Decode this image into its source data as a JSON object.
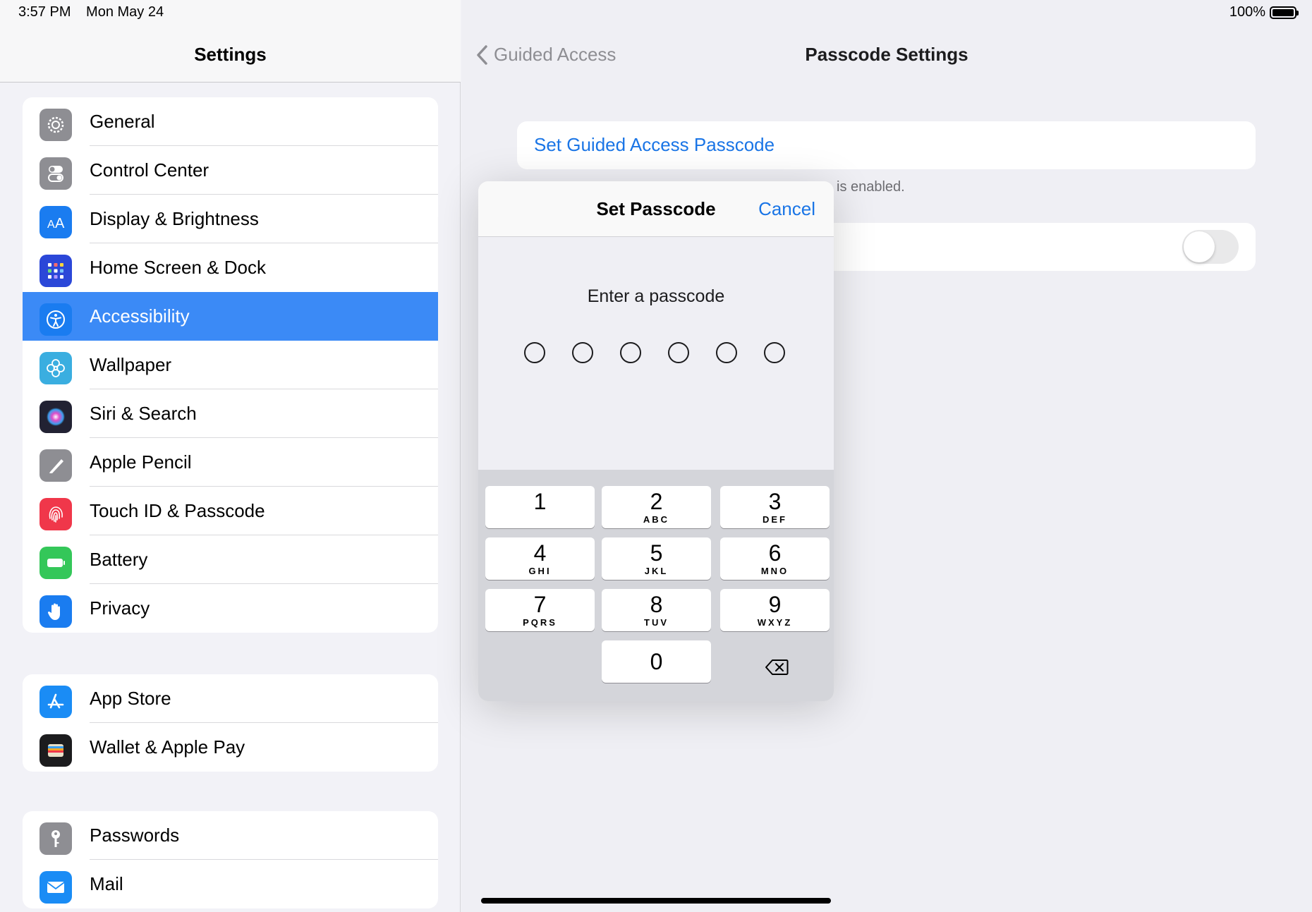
{
  "status": {
    "time": "3:57 PM",
    "date": "Mon May 24",
    "battery": "100%"
  },
  "sidebar": {
    "title": "Settings",
    "groups": [
      [
        {
          "label": "General",
          "icon": "gear-icon",
          "color": "#8e8e93"
        },
        {
          "label": "Control Center",
          "icon": "toggles-icon",
          "color": "#8e8e93"
        },
        {
          "label": "Display & Brightness",
          "icon": "text-size-icon",
          "color": "#1a7cf0"
        },
        {
          "label": "Home Screen & Dock",
          "icon": "app-grid-icon",
          "color": "#2b47d8"
        },
        {
          "label": "Accessibility",
          "icon": "accessibility-icon",
          "color": "#1a7cf0",
          "selected": true
        },
        {
          "label": "Wallpaper",
          "icon": "flower-icon",
          "color": "#3aaee0"
        },
        {
          "label": "Siri & Search",
          "icon": "siri-icon",
          "color": "#222233"
        },
        {
          "label": "Apple Pencil",
          "icon": "pencil-icon",
          "color": "#8e8e93"
        },
        {
          "label": "Touch ID & Passcode",
          "icon": "fingerprint-icon",
          "color": "#f0374a"
        },
        {
          "label": "Battery",
          "icon": "battery-icon",
          "color": "#34c759"
        },
        {
          "label": "Privacy",
          "icon": "hand-icon",
          "color": "#1a7cf0"
        }
      ],
      [
        {
          "label": "App Store",
          "icon": "app-store-icon",
          "color": "#1a8cf5"
        },
        {
          "label": "Wallet & Apple Pay",
          "icon": "wallet-icon",
          "color": "#1c1c1e"
        }
      ],
      [
        {
          "label": "Passwords",
          "icon": "key-icon",
          "color": "#8e8e93"
        },
        {
          "label": "Mail",
          "icon": "envelope-icon",
          "color": "#1a8cf5"
        }
      ]
    ]
  },
  "detail": {
    "back_label": "Guided Access",
    "title": "Passcode Settings",
    "set_passcode_link": "Set Guided Access Passcode",
    "footer_note": "is enabled.",
    "toggle_on": false
  },
  "modal": {
    "title": "Set Passcode",
    "cancel": "Cancel",
    "prompt": "Enter a passcode",
    "digits_entered": 0,
    "digits_total": 6
  },
  "keypad": [
    {
      "num": "1",
      "sub": ""
    },
    {
      "num": "2",
      "sub": "ABC"
    },
    {
      "num": "3",
      "sub": "DEF"
    },
    {
      "num": "4",
      "sub": "GHI"
    },
    {
      "num": "5",
      "sub": "JKL"
    },
    {
      "num": "6",
      "sub": "MNO"
    },
    {
      "num": "7",
      "sub": "PQRS"
    },
    {
      "num": "8",
      "sub": "TUV"
    },
    {
      "num": "9",
      "sub": "WXYZ"
    },
    {
      "num": "0",
      "sub": ""
    }
  ],
  "colors": {
    "accent": "#1a75e6",
    "selected_row": "#3b8af6"
  }
}
